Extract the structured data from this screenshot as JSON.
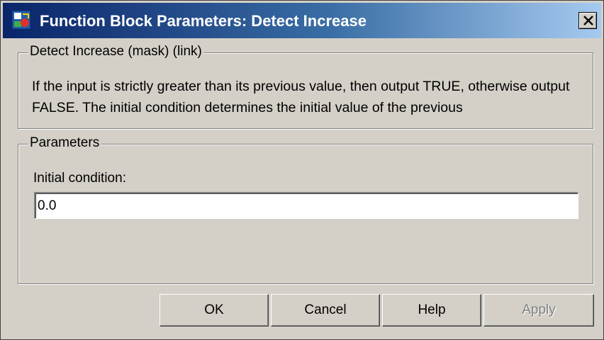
{
  "window": {
    "title": "Function Block Parameters: Detect Increase",
    "icon": "simulink-block-icon",
    "close_icon": "close-icon"
  },
  "description_group": {
    "legend": "Detect Increase (mask) (link)",
    "text": "If the input is strictly greater than its previous value, then output TRUE, otherwise output FALSE.  The initial condition determines the initial value of the previous"
  },
  "parameters_group": {
    "legend": "Parameters",
    "initial_condition": {
      "label": "Initial condition:",
      "value": "0.0"
    }
  },
  "buttons": {
    "ok": "OK",
    "cancel": "Cancel",
    "help": "Help",
    "apply": "Apply"
  },
  "colors": {
    "title_gradient_start": "#0a246a",
    "title_gradient_end": "#a6caf0",
    "window_background": "#d4d0c8"
  }
}
